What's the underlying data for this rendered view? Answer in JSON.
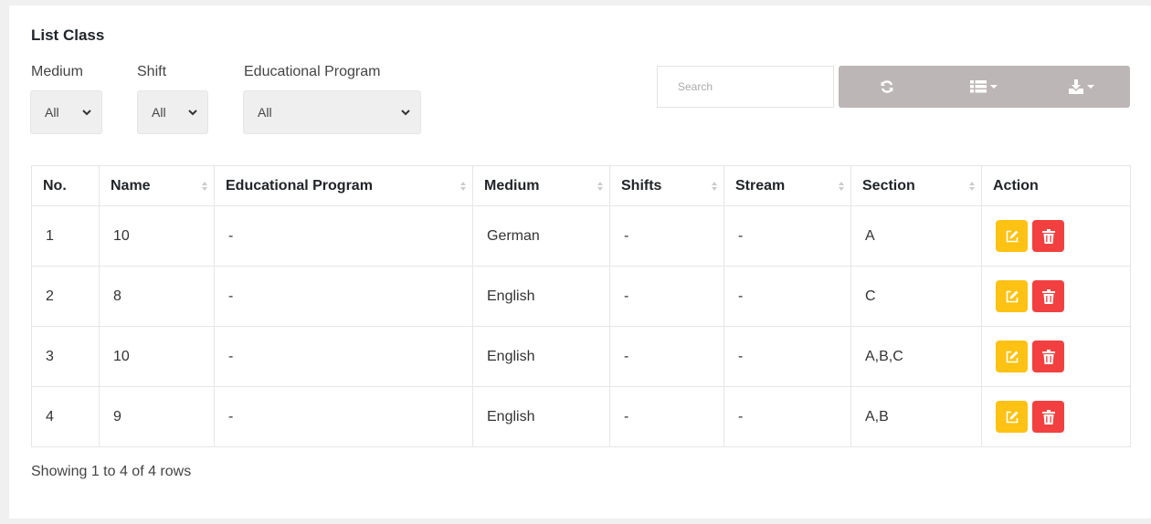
{
  "title": "List Class",
  "filters": {
    "medium": {
      "label": "Medium",
      "value": "All"
    },
    "shift": {
      "label": "Shift",
      "value": "All"
    },
    "program": {
      "label": "Educational Program",
      "value": "All"
    }
  },
  "search": {
    "placeholder": "Search"
  },
  "toolbar": {
    "refresh_icon": "refresh-icon",
    "columns_icon": "list-columns-icon",
    "export_icon": "download-icon"
  },
  "table": {
    "headers": [
      "No.",
      "Name",
      "Educational Program",
      "Medium",
      "Shifts",
      "Stream",
      "Section",
      "Action"
    ],
    "rows": [
      {
        "no": "1",
        "name": "10",
        "program": "-",
        "medium": "German",
        "shifts": "-",
        "stream": "-",
        "section": "A"
      },
      {
        "no": "2",
        "name": "8",
        "program": "-",
        "medium": "English",
        "shifts": "-",
        "stream": "-",
        "section": "C"
      },
      {
        "no": "3",
        "name": "10",
        "program": "-",
        "medium": "English",
        "shifts": "-",
        "stream": "-",
        "section": "A,B,C"
      },
      {
        "no": "4",
        "name": "9",
        "program": "-",
        "medium": "English",
        "shifts": "-",
        "stream": "-",
        "section": "A,B"
      }
    ]
  },
  "footer": {
    "summary": "Showing 1 to 4 of 4 rows"
  },
  "colors": {
    "edit": "#fdc213",
    "delete": "#f24040",
    "toolbar": "#bdb6b6"
  }
}
